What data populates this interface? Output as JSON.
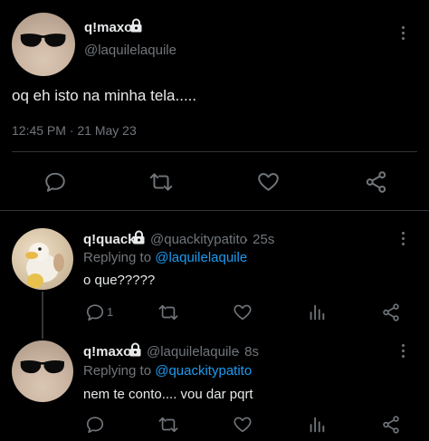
{
  "main_tweet": {
    "display_name": "q!maxo",
    "handle": "@laquilelaquile",
    "text": "oq eh isto na minha tela.....",
    "timestamp": "12:45 PM · 21 May 23"
  },
  "replies": [
    {
      "display_name": "q!quack",
      "handle": "@quackitypatito",
      "age": "· 25s",
      "replying_to_label": "Replying to",
      "replying_to_handle": "@laquilelaquile",
      "text": "o que?????",
      "reply_count": "1"
    },
    {
      "display_name": "q!maxo",
      "handle": "@laquilelaquile",
      "age": "· 8s",
      "replying_to_label": "Replying to",
      "replying_to_handle": "@quackitypatito",
      "text": "nem te conto.... vou dar pqrt",
      "reply_count": ""
    }
  ],
  "icons": [
    "lock-icon",
    "more-icon",
    "reply-icon",
    "retweet-icon",
    "like-icon",
    "share-icon",
    "views-icon"
  ],
  "colors": {
    "background": "#000000",
    "text": "#e7e9ea",
    "muted": "#71767b",
    "link": "#1d9bf0",
    "divider": "#2f3336"
  }
}
